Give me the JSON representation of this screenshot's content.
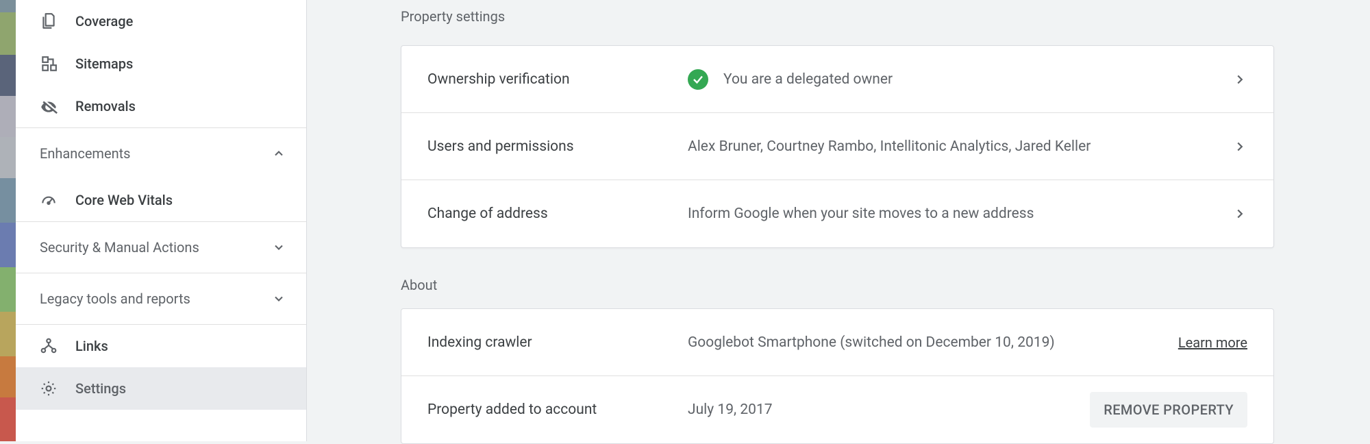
{
  "sidebar": {
    "items": [
      {
        "label": "Coverage"
      },
      {
        "label": "Sitemaps"
      },
      {
        "label": "Removals"
      }
    ],
    "enhancements": {
      "label": "Enhancements",
      "items": [
        {
          "label": "Core Web Vitals"
        }
      ]
    },
    "security_section": {
      "label": "Security & Manual Actions"
    },
    "legacy_section": {
      "label": "Legacy tools and reports"
    },
    "links_item": {
      "label": "Links"
    },
    "settings_item": {
      "label": "Settings"
    }
  },
  "property_settings": {
    "title": "Property settings",
    "rows": [
      {
        "label": "Ownership verification",
        "value": "You are a delegated owner"
      },
      {
        "label": "Users and permissions",
        "value": "Alex Bruner, Courtney Rambo, Intellitonic Analytics, Jared Keller"
      },
      {
        "label": "Change of address",
        "value": "Inform Google when your site moves to a new address"
      }
    ]
  },
  "about": {
    "title": "About",
    "indexing": {
      "label": "Indexing crawler",
      "value": "Googlebot Smartphone (switched on December 10, 2019)",
      "learn_more": "Learn more"
    },
    "added": {
      "label": "Property added to account",
      "value": "July 19, 2017",
      "remove_button": "REMOVE PROPERTY"
    }
  }
}
